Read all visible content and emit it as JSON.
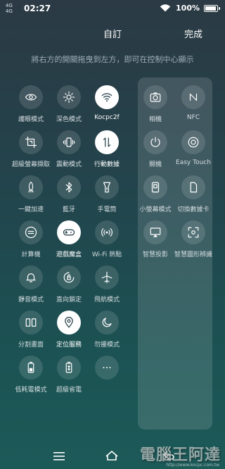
{
  "status": {
    "carrier_top": "4G",
    "carrier_bottom": "4G",
    "time": "02:27",
    "battery": "100%",
    "battery_level": 1.0
  },
  "header": {
    "title": "自訂",
    "done": "完成",
    "hint": "將右方的開關拖曳到左方，即可在控制中心顯示"
  },
  "left_tiles": [
    {
      "label": "護眼模式",
      "icon": "eye-icon",
      "on": false
    },
    {
      "label": "深色模式",
      "icon": "brightness-icon",
      "on": false
    },
    {
      "label": "Kocpc2f",
      "icon": "wifi-icon",
      "on": true
    },
    {
      "label": "超級螢幕擷取",
      "icon": "crop-icon",
      "on": false
    },
    {
      "label": "震動模式",
      "icon": "vibrate-icon",
      "on": false
    },
    {
      "label": "行動數據",
      "icon": "data-arrows-icon",
      "on": true
    },
    {
      "label": "一鍵加速",
      "icon": "rocket-icon",
      "on": false
    },
    {
      "label": "藍牙",
      "icon": "bluetooth-icon",
      "on": false
    },
    {
      "label": "手電筒",
      "icon": "flashlight-icon",
      "on": false
    },
    {
      "label": "計算機",
      "icon": "calculator-icon",
      "on": false
    },
    {
      "label": "遊戲魔盒",
      "icon": "gamepad-icon",
      "on": true
    },
    {
      "label": "Wi-Fi 熱點",
      "icon": "hotspot-icon",
      "on": false
    },
    {
      "label": "靜音模式",
      "icon": "bell-icon",
      "on": false
    },
    {
      "label": "直向鎖定",
      "icon": "rotation-lock-icon",
      "on": false
    },
    {
      "label": "飛航模式",
      "icon": "airplane-icon",
      "on": false
    },
    {
      "label": "分割畫面",
      "icon": "split-screen-icon",
      "on": false
    },
    {
      "label": "定位服務",
      "icon": "location-icon",
      "on": true
    },
    {
      "label": "勿擾模式",
      "icon": "moon-icon",
      "on": false
    },
    {
      "label": "低耗電模式",
      "icon": "battery-saver-icon",
      "on": false
    },
    {
      "label": "超級省電",
      "icon": "super-saver-icon",
      "on": false
    },
    {
      "label": "",
      "icon": "more-icon",
      "on": false
    }
  ],
  "right_tiles": [
    {
      "label": "相機",
      "icon": "camera-icon"
    },
    {
      "label": "NFC",
      "icon": "nfc-icon"
    },
    {
      "label": "關機",
      "icon": "power-icon"
    },
    {
      "label": "Easy Touch",
      "icon": "easy-touch-icon"
    },
    {
      "label": "小螢幕模式",
      "icon": "small-screen-icon"
    },
    {
      "label": "切換數據卡",
      "icon": "sim-card-icon"
    },
    {
      "label": "智慧投影",
      "icon": "cast-icon"
    },
    {
      "label": "智慧圖形辨識",
      "icon": "scan-icon"
    }
  ],
  "watermark": {
    "text": "電腦王阿達",
    "url": "http://www.kocpc.com.tw"
  }
}
